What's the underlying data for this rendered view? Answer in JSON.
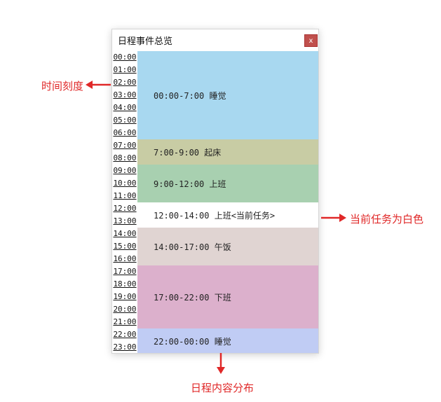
{
  "window": {
    "title": "日程事件总览",
    "close_label": "x"
  },
  "time_ticks": [
    "00:00",
    "01:00",
    "02:00",
    "03:00",
    "04:00",
    "05:00",
    "06:00",
    "07:00",
    "08:00",
    "09:00",
    "10:00",
    "11:00",
    "12:00",
    "13:00",
    "14:00",
    "15:00",
    "16:00",
    "17:00",
    "18:00",
    "19:00",
    "20:00",
    "21:00",
    "22:00",
    "23:00"
  ],
  "events": [
    {
      "label": "00:00-7:00 睡觉",
      "start": 0,
      "end": 7,
      "color": "#a8d8f0"
    },
    {
      "label": "7:00-9:00 起床",
      "start": 7,
      "end": 9,
      "color": "#c8cca4"
    },
    {
      "label": "9:00-12:00 上班",
      "start": 9,
      "end": 12,
      "color": "#a8d0b0"
    },
    {
      "label": "12:00-14:00 上班<当前任务>",
      "start": 12,
      "end": 14,
      "color": "#ffffff"
    },
    {
      "label": "14:00-17:00 午饭",
      "start": 14,
      "end": 17,
      "color": "#e0d4d2"
    },
    {
      "label": "17:00-22:00 下班",
      "start": 17,
      "end": 22,
      "color": "#dcb0cc"
    },
    {
      "label": "22:00-00:00 睡觉",
      "start": 22,
      "end": 24,
      "color": "#c0ccf4"
    }
  ],
  "annotations": {
    "time_scale": "时间刻度",
    "current_task": "当前任务为白色",
    "schedule_distribution": "日程内容分布",
    "color": "#e02828"
  }
}
